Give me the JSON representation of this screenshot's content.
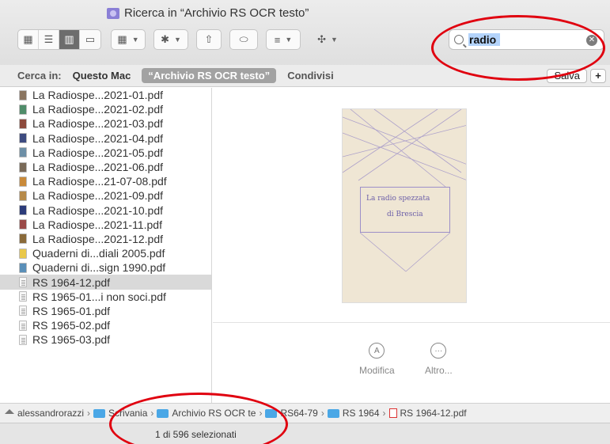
{
  "window": {
    "title": "Ricerca in “Archivio RS OCR testo”"
  },
  "search": {
    "query": "radio"
  },
  "scope": {
    "label": "Cerca in:",
    "options": [
      "Questo Mac",
      "“Archivio RS OCR testo”",
      "Condivisi"
    ],
    "save_label": "Salva",
    "add_label": "+"
  },
  "files": [
    "La Radiospe...2021-01.pdf",
    "La Radiospe...2021-02.pdf",
    "La Radiospe...2021-03.pdf",
    "La Radiospe...2021-04.pdf",
    "La Radiospe...2021-05.pdf",
    "La Radiospe...2021-06.pdf",
    "La Radiospe...21-07-08.pdf",
    "La Radiospe...2021-09.pdf",
    "La Radiospe...2021-10.pdf",
    "La Radiospe...2021-11.pdf",
    "La Radiospe...2021-12.pdf",
    "Quaderni di...diali 2005.pdf",
    "Quaderni di...sign 1990.pdf",
    "RS 1964-12.pdf",
    "RS 1965-01...i non soci.pdf",
    "RS 1965-01.pdf",
    "RS 1965-02.pdf",
    "RS 1965-03.pdf"
  ],
  "preview": {
    "doc_text_1": "La radio spezzata",
    "doc_text_2": "di Brescia",
    "actions": [
      {
        "label": "Modifica",
        "icon": "markup-icon"
      },
      {
        "label": "Altro...",
        "icon": "more-icon"
      }
    ]
  },
  "path": [
    "alessandrorazzi",
    "Scrivania",
    "Archivio RS OCR te",
    "RS64-79",
    "RS 1964",
    "RS 1964-12.pdf"
  ],
  "status": {
    "text": "1 di 596 selezionati"
  },
  "colors": {
    "annotation": "#e0000f",
    "selection": "#b3d3fb",
    "folder": "#4aa7e6"
  }
}
